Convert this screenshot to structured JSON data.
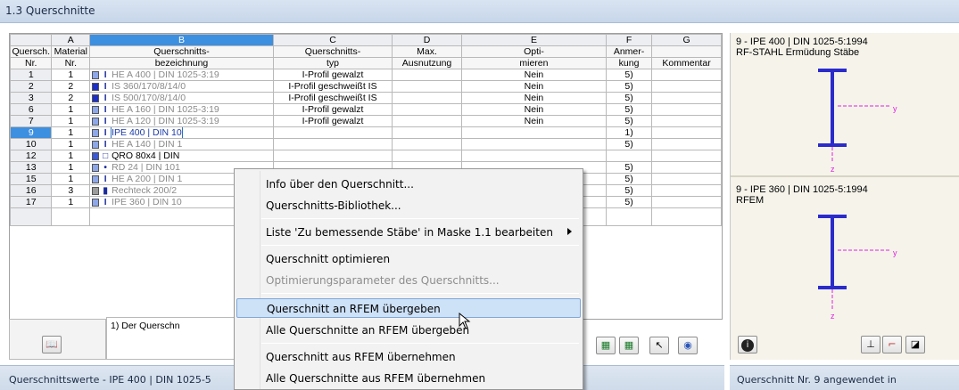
{
  "window": {
    "title": "1.3 Querschnitte"
  },
  "columns": {
    "letters": [
      "A",
      "B",
      "C",
      "D",
      "E",
      "F",
      "G"
    ]
  },
  "headers": {
    "row1": [
      "Quersch.",
      "Material",
      "Querschnitts-",
      "Querschnitts-",
      "Max.",
      "Opti-",
      "Anmer-",
      ""
    ],
    "row2": [
      "Nr.",
      "Nr.",
      "bezeichnung",
      "typ",
      "Ausnutzung",
      "mieren",
      "kung",
      "Kommentar"
    ]
  },
  "rows": [
    {
      "nr": "1",
      "mat": "1",
      "name": "HE A 400 | DIN 1025-3:19",
      "typ": "I-Profil gewalzt",
      "opt": "Nein",
      "anm": "5)",
      "color": "#8ea7e8",
      "icon": "I"
    },
    {
      "nr": "2",
      "mat": "2",
      "name": "IS 360/170/8/14/0",
      "typ": "I-Profil geschweißt IS",
      "opt": "Nein",
      "anm": "5)",
      "color": "#1d2fc4",
      "icon": "I"
    },
    {
      "nr": "3",
      "mat": "2",
      "name": "IS 500/170/8/14/0",
      "typ": "I-Profil geschweißt IS",
      "opt": "Nein",
      "anm": "5)",
      "color": "#1d2fc4",
      "icon": "I"
    },
    {
      "nr": "6",
      "mat": "1",
      "name": "HE A 160 | DIN 1025-3:19",
      "typ": "I-Profil gewalzt",
      "opt": "Nein",
      "anm": "5)",
      "color": "#8ea7e8",
      "icon": "I"
    },
    {
      "nr": "7",
      "mat": "1",
      "name": "HE A 120 | DIN 1025-3:19",
      "typ": "I-Profil gewalzt",
      "opt": "Nein",
      "anm": "5)",
      "color": "#8ea7e8",
      "icon": "I"
    },
    {
      "nr": "9",
      "mat": "1",
      "name": "IPE 400 | DIN 10",
      "typ": "",
      "opt": "",
      "anm": "1)",
      "color": "#8ea7e8",
      "icon": "I"
    },
    {
      "nr": "10",
      "mat": "1",
      "name": "HE A 140 | DIN 1",
      "typ": "",
      "opt": "",
      "anm": "5)",
      "color": "#8ea7e8",
      "icon": "I"
    },
    {
      "nr": "12",
      "mat": "1",
      "name": "QRO 80x4 | DIN",
      "typ": "",
      "opt": "",
      "anm": "",
      "color": "#3b58d8",
      "icon": "□"
    },
    {
      "nr": "13",
      "mat": "1",
      "name": "RD 24 | DIN 101",
      "typ": "",
      "opt": "",
      "anm": "5)",
      "color": "#8ea7e8",
      "icon": "•"
    },
    {
      "nr": "15",
      "mat": "1",
      "name": "HE A 200 | DIN 1",
      "typ": "",
      "opt": "",
      "anm": "5)",
      "color": "#8ea7e8",
      "icon": "I"
    },
    {
      "nr": "16",
      "mat": "3",
      "name": "Rechteck 200/2",
      "typ": "",
      "opt": "",
      "anm": "5)",
      "color": "#9c9c9c",
      "icon": "▮"
    },
    {
      "nr": "17",
      "mat": "1",
      "name": "IPE 360 | DIN 10",
      "typ": "",
      "opt": "",
      "anm": "5)",
      "color": "#8ea7e8",
      "icon": "I"
    }
  ],
  "footnote": "1) Der Querschn",
  "status_left": "Querschnittswerte  -  IPE 400 | DIN 1025-5",
  "right": {
    "sec1_title": "9 - IPE 400 | DIN 1025-5:1994",
    "sec1_sub": "RF-STAHL Ermüdung Stäbe",
    "sec2_title": "9 - IPE 360 | DIN 1025-5:1994",
    "sec2_sub": "RFEM",
    "axis_y": "y",
    "axis_z": "z",
    "status": "Querschnitt Nr. 9 angewendet in"
  },
  "menu": {
    "items": [
      "Info über den Querschnitt...",
      "Querschnitts-Bibliothek...",
      "Liste 'Zu bemessende Stäbe' in Maske 1.1 bearbeiten",
      "Querschnitt optimieren",
      "Optimierungsparameter des Querschnitts...",
      "Querschnitt an RFEM übergeben",
      "Alle Querschnitte an RFEM übergeben",
      "Querschnitt aus RFEM übernehmen",
      "Alle Querschnitte aus RFEM übernehmen"
    ]
  },
  "icons": {
    "bottom_left": "library-icon",
    "bottom_tools": [
      "excel-import-icon",
      "excel-export-icon",
      "select-icon",
      "view-icon"
    ],
    "right_tools": [
      "info-icon",
      "section-icon",
      "axes-icon",
      "render-icon"
    ]
  }
}
